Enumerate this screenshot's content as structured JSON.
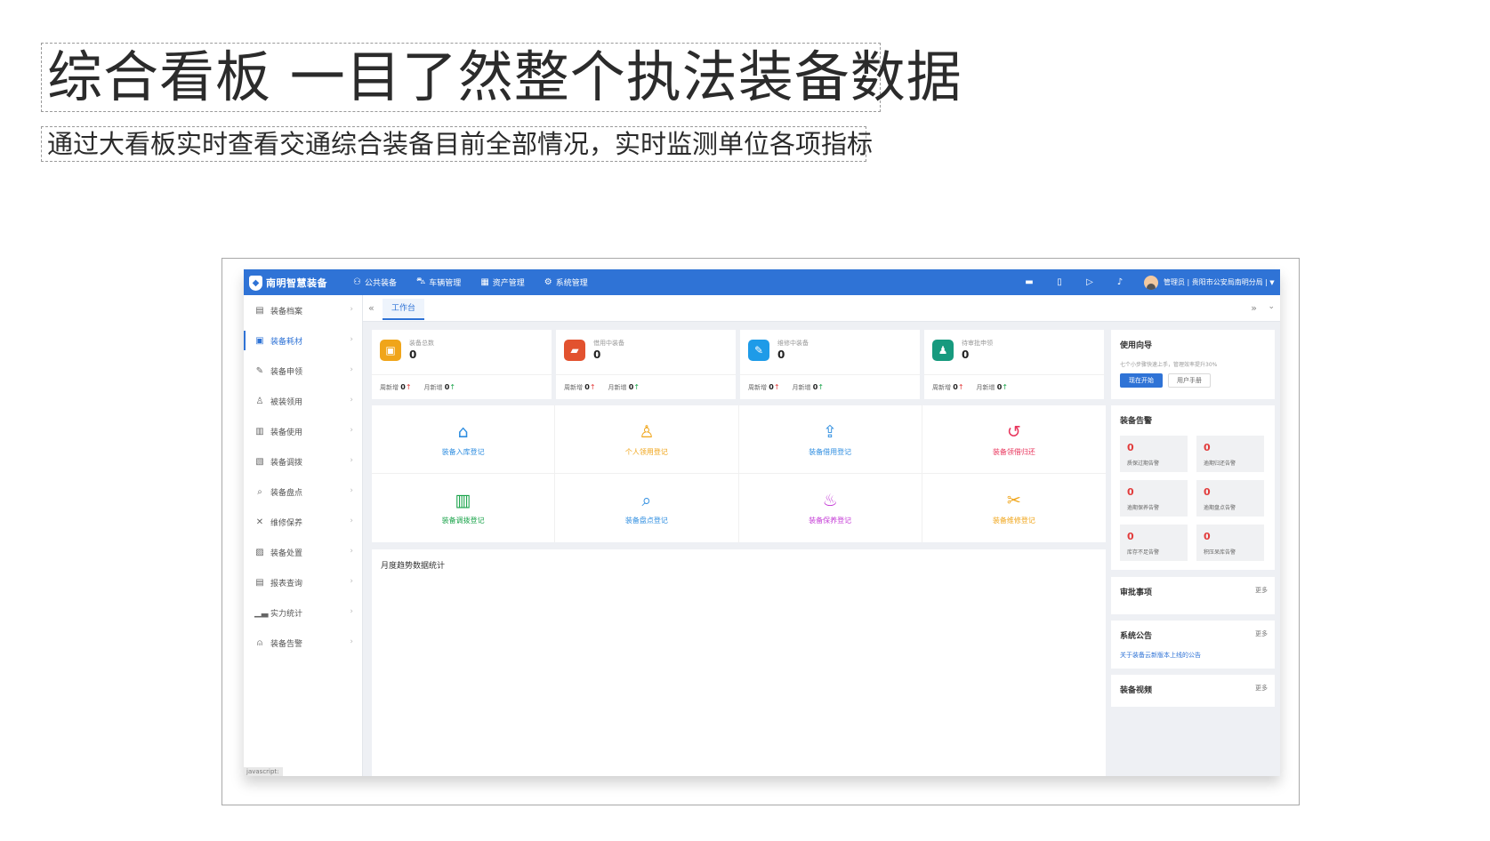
{
  "slide": {
    "title": "综合看板 一目了然整个执法装备数据",
    "subtitle": "通过大看板实时查看交通综合装备目前全部情况，实时监测单位各项指标"
  },
  "topbar": {
    "logo_text": "南明智慧装备",
    "nav": [
      {
        "label": "公共装备",
        "icon": "users-icon"
      },
      {
        "label": "车辆管理",
        "icon": "car-icon"
      },
      {
        "label": "资产管理",
        "icon": "building-icon"
      },
      {
        "label": "系统管理",
        "icon": "gear-icon"
      }
    ],
    "user_label": "管理员 | 贵阳市公安局南明分局 |"
  },
  "sidebar": {
    "items": [
      {
        "label": "装备档案",
        "icon": "archive-icon"
      },
      {
        "label": "装备耗材",
        "icon": "consumable-icon"
      },
      {
        "label": "装备申领",
        "icon": "apply-icon"
      },
      {
        "label": "被装领用",
        "icon": "uniform-icon"
      },
      {
        "label": "装备使用",
        "icon": "usage-icon"
      },
      {
        "label": "装备调拨",
        "icon": "transfer-icon"
      },
      {
        "label": "装备盘点",
        "icon": "inventory-icon"
      },
      {
        "label": "维修保养",
        "icon": "tools-icon"
      },
      {
        "label": "装备处置",
        "icon": "disposal-icon"
      },
      {
        "label": "报表查询",
        "icon": "report-icon"
      },
      {
        "label": "实力统计",
        "icon": "chart-icon"
      },
      {
        "label": "装备告警",
        "icon": "alarm-icon"
      }
    ],
    "active_index": 1,
    "status_text": "javascript:"
  },
  "tabs": {
    "active_label": "工作台"
  },
  "stats": [
    {
      "label": "装备总数",
      "value": "0",
      "color": "#f0a51a",
      "week_label": "周新增",
      "week_value": "0",
      "month_label": "月新增",
      "month_value": "0"
    },
    {
      "label": "借用中装备",
      "value": "0",
      "color": "#e2522f",
      "week_label": "周新增",
      "week_value": "0",
      "month_label": "月新增",
      "month_value": "0"
    },
    {
      "label": "维修中装备",
      "value": "0",
      "color": "#1e9be8",
      "week_label": "周新增",
      "week_value": "0",
      "month_label": "月新增",
      "month_value": "0"
    },
    {
      "label": "待审批申领",
      "value": "0",
      "color": "#179a7e",
      "week_label": "周新增",
      "week_value": "0",
      "month_label": "月新增",
      "month_value": "0"
    }
  ],
  "quick_actions": [
    {
      "label": "装备入库登记",
      "color": "#2f8ee0",
      "icon": "house-in-icon"
    },
    {
      "label": "个人领用登记",
      "color": "#f0a51a",
      "icon": "person-icon"
    },
    {
      "label": "装备借用登记",
      "color": "#2f8ee0",
      "icon": "borrow-icon"
    },
    {
      "label": "装备领借归还",
      "color": "#e8365d",
      "icon": "return-icon"
    },
    {
      "label": "装备调拨登记",
      "color": "#1aa34a",
      "icon": "store-icon"
    },
    {
      "label": "装备盘点登记",
      "color": "#2f8ee0",
      "icon": "inventory-check-icon"
    },
    {
      "label": "装备保养登记",
      "color": "#c43bd6",
      "icon": "maintain-icon"
    },
    {
      "label": "装备维修登记",
      "color": "#f0a51a",
      "icon": "repair-icon"
    }
  ],
  "chart_panel": {
    "title": "月度趋势数据统计"
  },
  "guide": {
    "title": "使用向导",
    "desc": "七个小步骤快速上手，管理效率提升30%",
    "primary_btn": "现在开始",
    "secondary_btn": "用户手册"
  },
  "alarms": {
    "title": "装备告警",
    "items": [
      {
        "value": "0",
        "label": "质保过期告警"
      },
      {
        "value": "0",
        "label": "逾期归还告警"
      },
      {
        "value": "0",
        "label": "逾期保养告警"
      },
      {
        "value": "0",
        "label": "逾期盘点告警"
      },
      {
        "value": "0",
        "label": "库存不足告警"
      },
      {
        "value": "0",
        "label": "积压呆库告警"
      }
    ]
  },
  "approvals": {
    "title": "审批事项",
    "more": "更多"
  },
  "notices": {
    "title": "系统公告",
    "more": "更多",
    "first_item": "关于装备云新版本上线的公告"
  },
  "videos": {
    "title": "装备视频",
    "more": "更多"
  }
}
